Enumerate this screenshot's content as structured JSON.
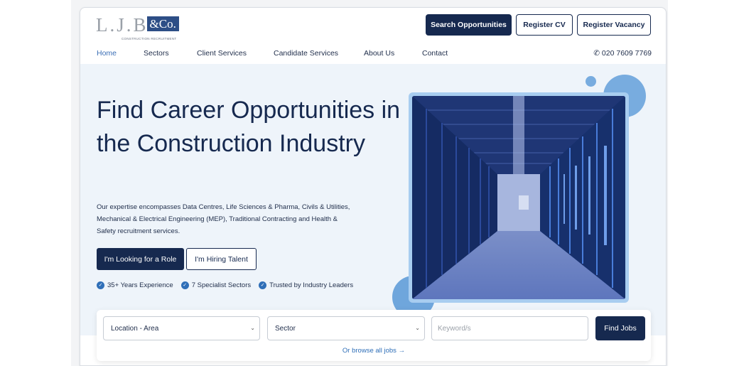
{
  "logo": {
    "main": "L.J.B",
    "co": "&Co.",
    "sub": "CONSTRUCTION RECRUITMENT"
  },
  "header": {
    "search_label": "Search Opportunities",
    "register_cv_label": "Register CV",
    "register_vacancy_label": "Register Vacancy"
  },
  "nav": {
    "items": [
      "Home",
      "Sectors",
      "Client Services",
      "Candidate Services",
      "About Us",
      "Contact"
    ],
    "phone": "020 7609 7769"
  },
  "hero": {
    "title": "Find Career Opportunities in the Construction Industry",
    "description": "Our expertise encompasses Data Centres, Life Sciences & Pharma, Civils & Utilities, Mechanical & Electrical Engineering (MEP), Traditional Contracting and Health & Safety recruitment services.",
    "primary_button": "I'm Looking for a Role",
    "secondary_button": "I'm Hiring Talent",
    "features": [
      "35+ Years Experience",
      "7 Specialist Sectors",
      "Trusted by Industry Leaders"
    ]
  },
  "search": {
    "location_value": "Location - Area",
    "sector_value": "Sector",
    "keyword_placeholder": "Keyword/s",
    "find_label": "Find Jobs",
    "browse_label": "Or browse all jobs →"
  },
  "colors": {
    "primary": "#16294f",
    "accent": "#2f6fb8",
    "hero_bg": "#eef4fa"
  }
}
